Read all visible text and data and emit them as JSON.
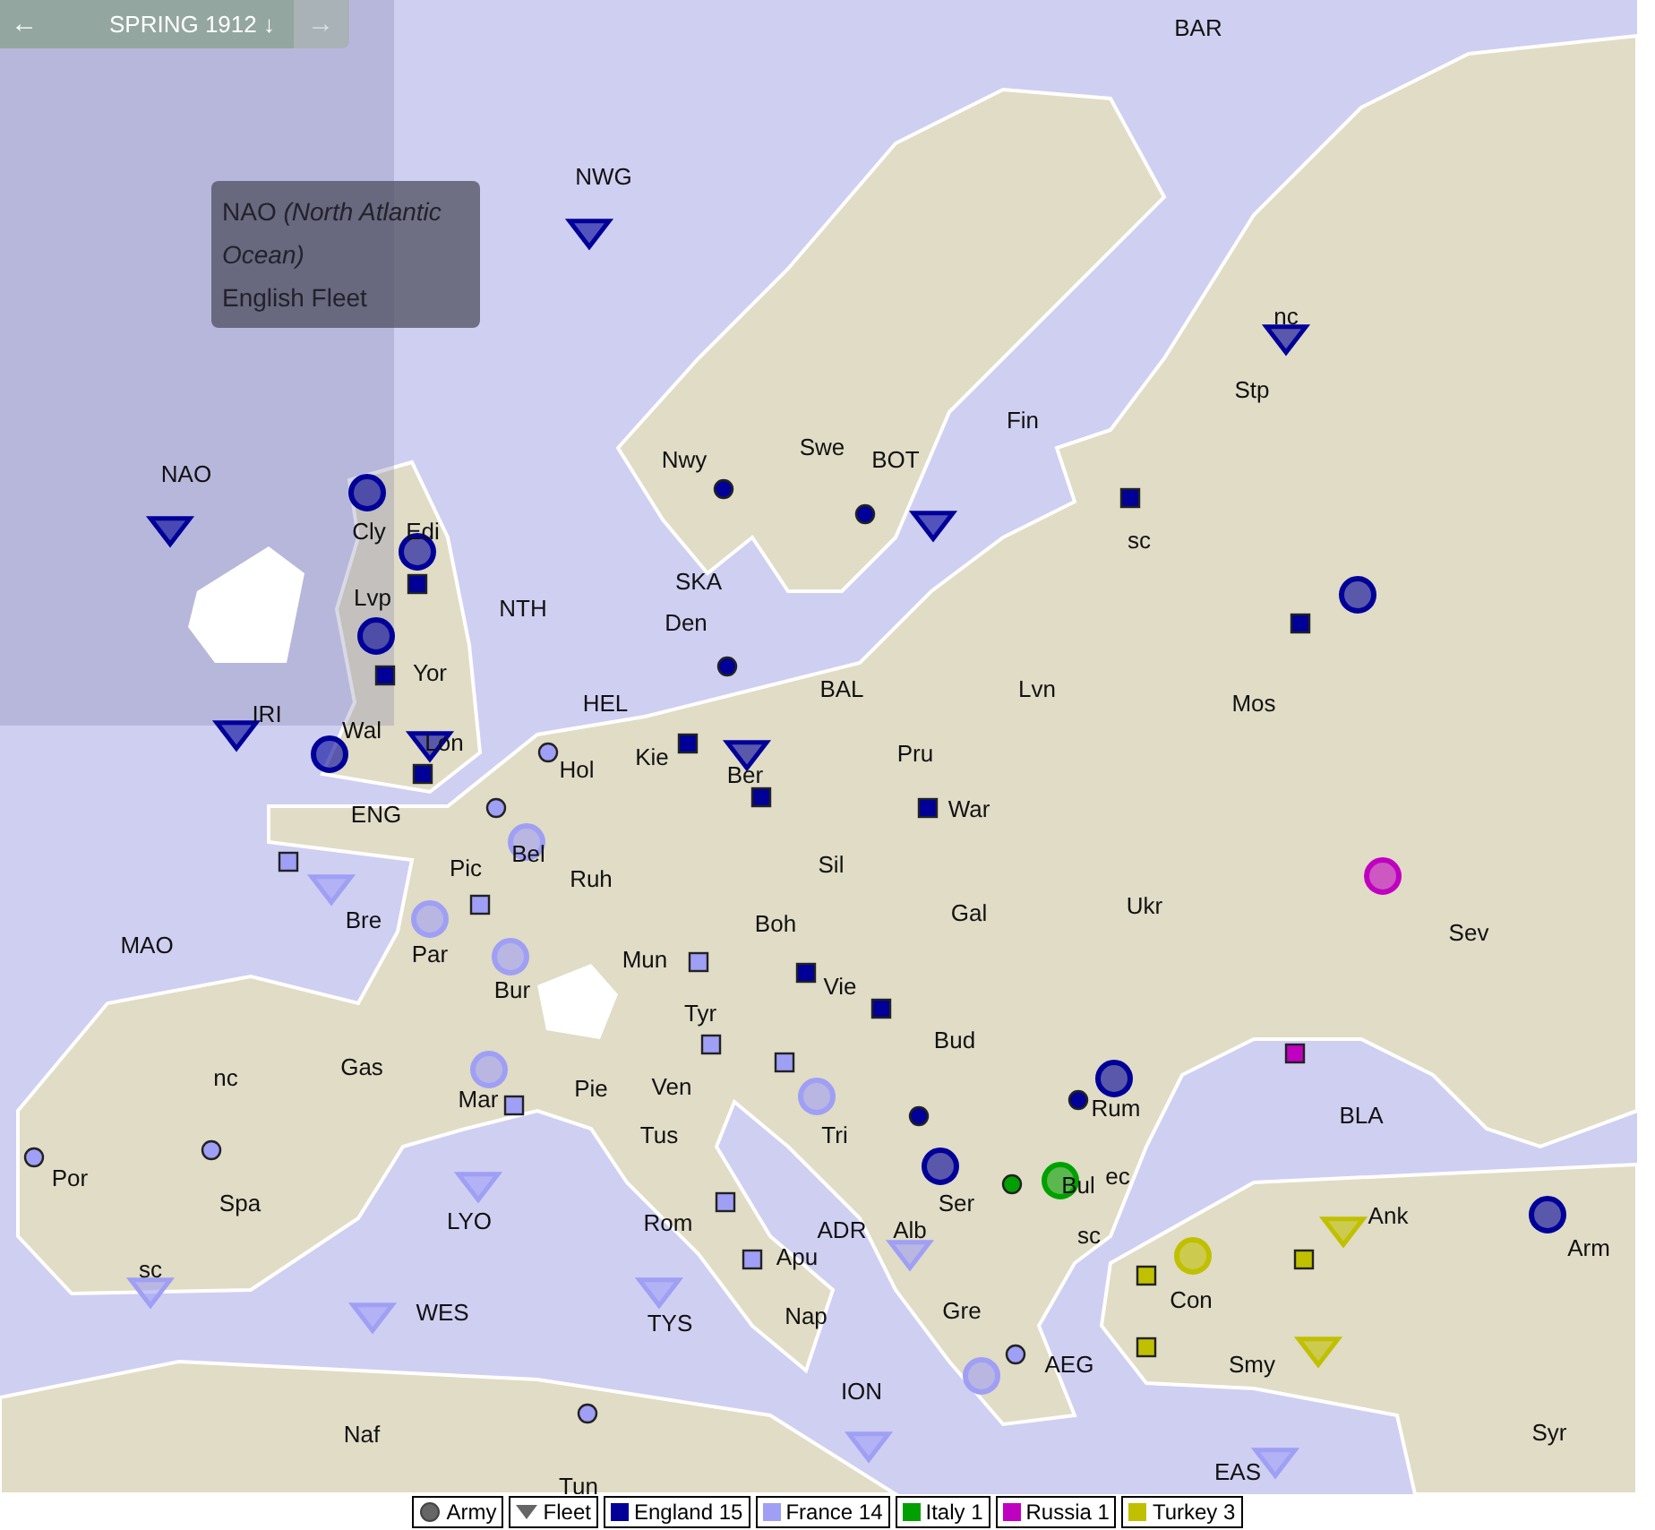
{
  "phase": {
    "prev": "←",
    "label": "SPRING 1912",
    "down": "↓",
    "next": "→",
    "next_disabled": true
  },
  "tooltip": {
    "abbr": "NAO",
    "name": "(North Atlantic Ocean)",
    "unit": "English Fleet"
  },
  "labels": [
    "BAR",
    "NWG",
    "NAO",
    "Nwy",
    "Swe",
    "BOT",
    "Fin",
    "nc",
    "Stp",
    "Cly",
    "Edi",
    "Lvp",
    "NTH",
    "SKA",
    "Den",
    "sc",
    "Yor",
    "Mos",
    "Lvn",
    "HEL",
    "BAL",
    "IRI",
    "Wal",
    "Lon",
    "Kie",
    "Ber",
    "Pru",
    "Hol",
    "War",
    "ENG",
    "Bel",
    "Pic",
    "Sil",
    "Ruh",
    "Ukr",
    "Sev",
    "Gal",
    "Bre",
    "MAO",
    "Par",
    "Boh",
    "Mun",
    "Bur",
    "Vie",
    "Tyr",
    "Bud",
    "nc",
    "Gas",
    "Mar",
    "Pie",
    "Ven",
    "Tri",
    "Rum",
    "BLA",
    "Tus",
    "Por",
    "Spa",
    "Ser",
    "Bul",
    "ec",
    "LYO",
    "Rom",
    "ADR",
    "Alb",
    "sc",
    "Ank",
    "Arm",
    "Apu",
    "Con",
    "sc",
    "WES",
    "TYS",
    "Nap",
    "Gre",
    "Smy",
    "AEG",
    "ION",
    "Naf",
    "Syr",
    "EAS",
    "Tun"
  ],
  "units": [
    {
      "kind": "army",
      "color": "#000099"
    },
    {
      "kind": "army",
      "color": "#000099"
    },
    {
      "kind": "army",
      "color": "#000099"
    },
    {
      "kind": "army",
      "color": "#000099"
    },
    {
      "kind": "army",
      "color": "#9f9ff5"
    },
    {
      "kind": "army",
      "color": "#9f9ff5"
    },
    {
      "kind": "army",
      "color": "#9f9ff5"
    },
    {
      "kind": "army",
      "color": "#9f9ff5"
    },
    {
      "kind": "army",
      "color": "#9f9ff5"
    },
    {
      "kind": "army",
      "color": "#000099"
    },
    {
      "kind": "army",
      "color": "#000099"
    },
    {
      "kind": "army",
      "color": "#00a000"
    },
    {
      "kind": "army",
      "color": "#000099"
    },
    {
      "kind": "army",
      "color": "#c000c0"
    },
    {
      "kind": "army",
      "color": "#c0c000"
    },
    {
      "kind": "army",
      "color": "#000099"
    },
    {
      "kind": "army",
      "color": "#9f9ff5"
    },
    {
      "kind": "fleet",
      "color": "#000099"
    },
    {
      "kind": "fleet",
      "color": "#000099"
    },
    {
      "kind": "fleet",
      "color": "#000099"
    },
    {
      "kind": "fleet",
      "color": "#000099"
    },
    {
      "kind": "fleet",
      "color": "#000099"
    },
    {
      "kind": "fleet",
      "color": "#000099"
    },
    {
      "kind": "fleet",
      "color": "#000099"
    },
    {
      "kind": "fleet",
      "color": "#9f9ff5"
    },
    {
      "kind": "fleet",
      "color": "#9f9ff5"
    },
    {
      "kind": "fleet",
      "color": "#9f9ff5"
    },
    {
      "kind": "fleet",
      "color": "#9f9ff5"
    },
    {
      "kind": "fleet",
      "color": "#9f9ff5"
    },
    {
      "kind": "fleet",
      "color": "#9f9ff5"
    },
    {
      "kind": "fleet",
      "color": "#9f9ff5"
    },
    {
      "kind": "fleet",
      "color": "#9f9ff5"
    },
    {
      "kind": "fleet",
      "color": "#c0c000"
    },
    {
      "kind": "fleet",
      "color": "#c0c000"
    }
  ],
  "centers": [
    {
      "kind": "square",
      "color": "#000099"
    },
    {
      "kind": "square",
      "color": "#000099"
    },
    {
      "kind": "square",
      "color": "#000099"
    },
    {
      "kind": "square",
      "color": "#000099"
    },
    {
      "kind": "square",
      "color": "#000099"
    },
    {
      "kind": "square",
      "color": "#000099"
    },
    {
      "kind": "square",
      "color": "#000099"
    },
    {
      "kind": "square",
      "color": "#000099"
    },
    {
      "kind": "square",
      "color": "#000099"
    },
    {
      "kind": "square",
      "color": "#000099"
    },
    {
      "kind": "square",
      "color": "#c000c0"
    },
    {
      "kind": "square",
      "color": "#9f9ff5"
    },
    {
      "kind": "square",
      "color": "#9f9ff5"
    },
    {
      "kind": "square",
      "color": "#9f9ff5"
    },
    {
      "kind": "square",
      "color": "#9f9ff5"
    },
    {
      "kind": "square",
      "color": "#9f9ff5"
    },
    {
      "kind": "square",
      "color": "#9f9ff5"
    },
    {
      "kind": "square",
      "color": "#9f9ff5"
    },
    {
      "kind": "square",
      "color": "#9f9ff5"
    },
    {
      "kind": "square",
      "color": "#c0c000"
    },
    {
      "kind": "square",
      "color": "#c0c000"
    },
    {
      "kind": "square",
      "color": "#c0c000"
    },
    {
      "kind": "dot",
      "color": "#000099"
    },
    {
      "kind": "dot",
      "color": "#000099"
    },
    {
      "kind": "dot",
      "color": "#000099"
    },
    {
      "kind": "dot",
      "color": "#9f9ff5"
    },
    {
      "kind": "dot",
      "color": "#9f9ff5"
    },
    {
      "kind": "dot",
      "color": "#9f9ff5"
    },
    {
      "kind": "dot",
      "color": "#9f9ff5"
    },
    {
      "kind": "dot",
      "color": "#9f9ff5"
    },
    {
      "kind": "dot",
      "color": "#000099"
    },
    {
      "kind": "dot",
      "color": "#000099"
    },
    {
      "kind": "dot",
      "color": "#00a000"
    },
    {
      "kind": "dot",
      "color": "#9f9ff5"
    }
  ],
  "legend": [
    {
      "kind": "army",
      "label": "Army"
    },
    {
      "kind": "fleet",
      "label": "Fleet"
    },
    {
      "kind": "country",
      "label": "England 15",
      "color": "#000099"
    },
    {
      "kind": "country",
      "label": "France 14",
      "color": "#9f9ff5"
    },
    {
      "kind": "country",
      "label": "Italy 1",
      "color": "#00a000"
    },
    {
      "kind": "country",
      "label": "Russia 1",
      "color": "#c000c0"
    },
    {
      "kind": "country",
      "label": "Turkey 3",
      "color": "#c0c000"
    }
  ]
}
